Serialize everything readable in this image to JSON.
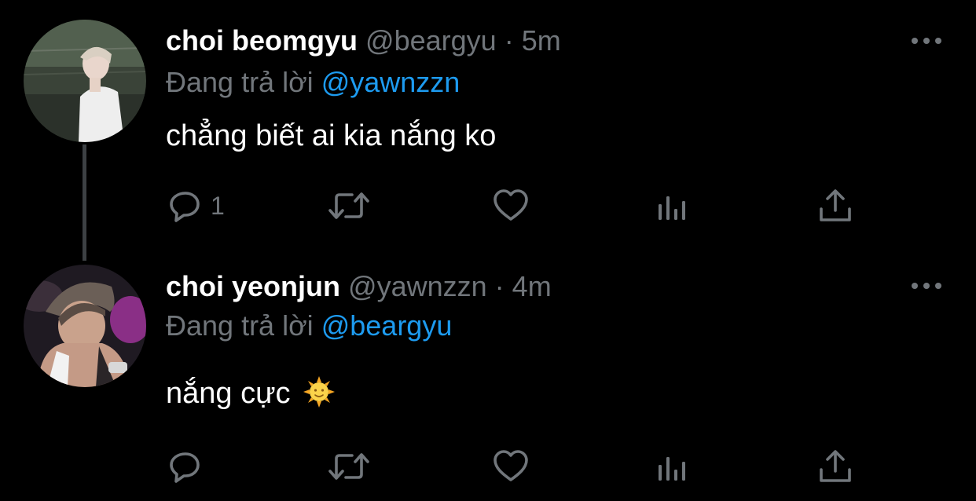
{
  "tweets": [
    {
      "display_name": "choi beomgyu",
      "handle": "@beargyu",
      "separator": "·",
      "time": "5m",
      "reply_prefix": "Đang trả lời",
      "reply_to": "@yawnzzn",
      "text": "chẳng biết ai kia nắng ko",
      "reply_count": "1"
    },
    {
      "display_name": "choi yeonjun",
      "handle": "@yawnzzn",
      "separator": "·",
      "time": "4m",
      "reply_prefix": "Đang trả lời",
      "reply_to": "@beargyu",
      "text": "nắng cực",
      "emoji": "sun-with-face",
      "reply_count": ""
    }
  ],
  "icons": {
    "reply": "reply-icon",
    "retweet": "retweet-icon",
    "like": "heart-icon",
    "views": "views-icon",
    "share": "share-icon",
    "more": "more-icon"
  },
  "colors": {
    "background": "#000000",
    "text": "#ffffff",
    "muted": "#71767b",
    "accent": "#1d9bf0",
    "thread_line": "#3d4144"
  }
}
